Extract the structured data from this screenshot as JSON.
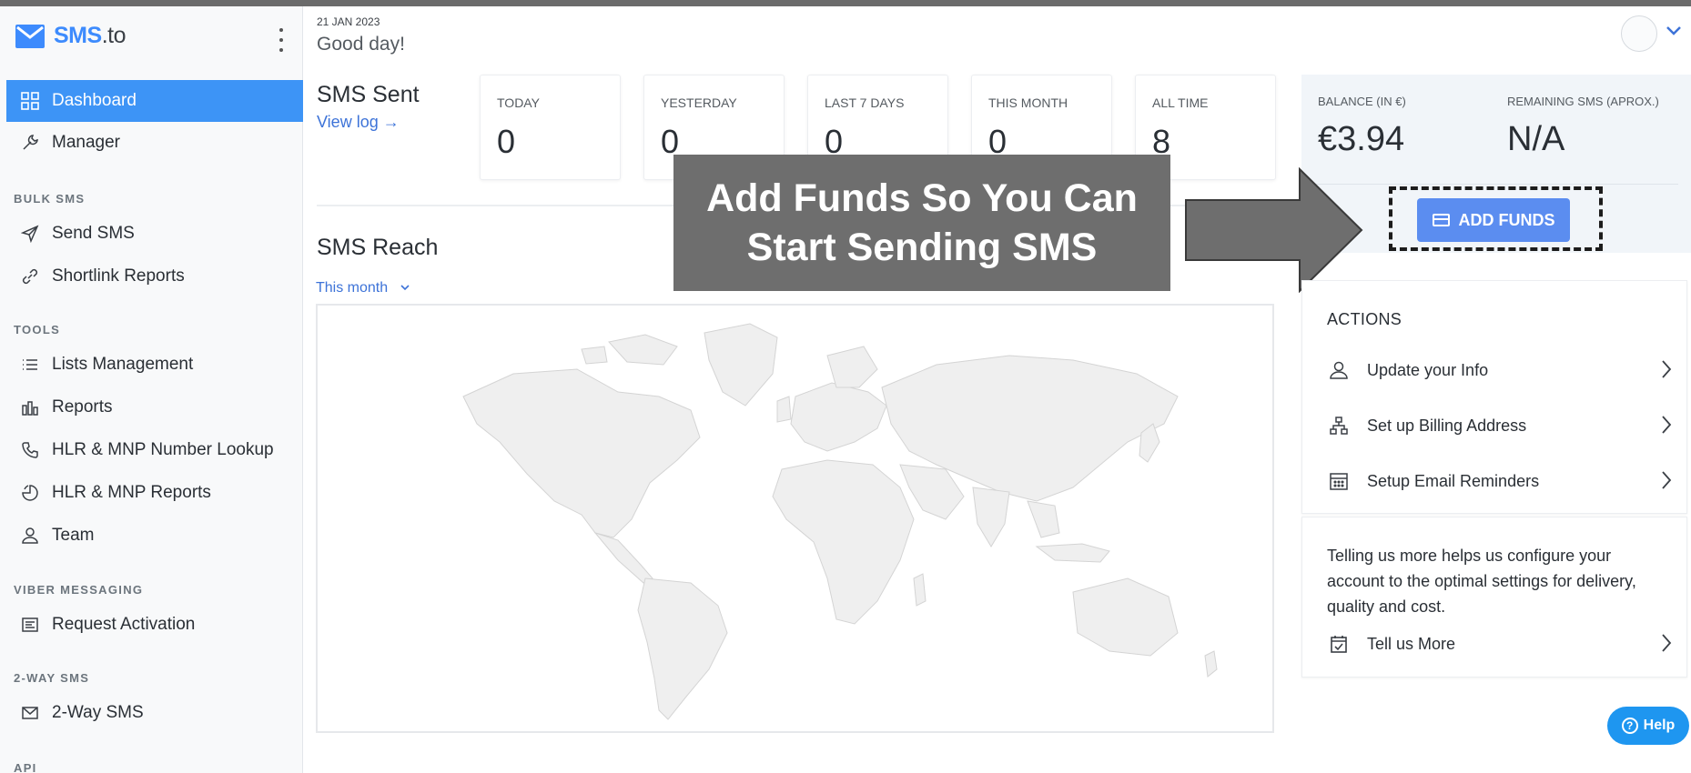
{
  "app": {
    "brand_primary": "SMS",
    "brand_secondary": ".to",
    "accent_color": "#3d94f6"
  },
  "sidebar": {
    "items": [
      {
        "label": "Dashboard",
        "icon": "grid-icon",
        "active": true
      },
      {
        "label": "Manager",
        "icon": "wrench-icon"
      },
      {
        "label": "Send SMS",
        "icon": "send-icon"
      },
      {
        "label": "Shortlink Reports",
        "icon": "link-icon"
      },
      {
        "label": "Lists Management",
        "icon": "list-icon"
      },
      {
        "label": "Reports",
        "icon": "bar-chart-icon"
      },
      {
        "label": "HLR & MNP Number Lookup",
        "icon": "phone-icon"
      },
      {
        "label": "HLR & MNP Reports",
        "icon": "pie-icon"
      },
      {
        "label": "Team",
        "icon": "user-icon"
      },
      {
        "label": "Request Activation",
        "icon": "form-icon"
      },
      {
        "label": "2-Way SMS",
        "icon": "envelope-icon"
      }
    ],
    "sections": {
      "bulk": "BULK SMS",
      "tools": "TOOLS",
      "viber": "VIBER MESSAGING",
      "twoway": "2-WAY SMS",
      "api": "API"
    }
  },
  "header": {
    "date": "21 JAN 2023",
    "greeting": "Good day!"
  },
  "sms_sent": {
    "title": "SMS Sent",
    "view_log": "View log →",
    "stats": [
      {
        "label": "TODAY",
        "value": "0"
      },
      {
        "label": "YESTERDAY",
        "value": "0"
      },
      {
        "label": "LAST 7 DAYS",
        "value": "0"
      },
      {
        "label": "THIS MONTH",
        "value": "0"
      },
      {
        "label": "ALL TIME",
        "value": "8"
      }
    ]
  },
  "balance": {
    "balance_label": "BALANCE (IN €)",
    "balance_value": "€3.94",
    "remaining_label": "REMAINING SMS (APROX.)",
    "remaining_value": "N/A",
    "add_funds_label": "ADD FUNDS"
  },
  "reach": {
    "title": "SMS Reach",
    "period": "This month"
  },
  "callout": {
    "line1": "Add Funds So You Can",
    "line2": "Start Sending SMS"
  },
  "actions": {
    "title": "ACTIONS",
    "items": [
      {
        "label": "Update your Info",
        "icon": "user-icon"
      },
      {
        "label": "Set up Billing Address",
        "icon": "sitemap-icon"
      },
      {
        "label": "Setup Email Reminders",
        "icon": "calendar-icon"
      }
    ]
  },
  "tell": {
    "text": "Telling us more helps us configure your account to the optimal settings for delivery, quality and cost.",
    "link": "Tell us More"
  },
  "help": {
    "label": "Help"
  }
}
